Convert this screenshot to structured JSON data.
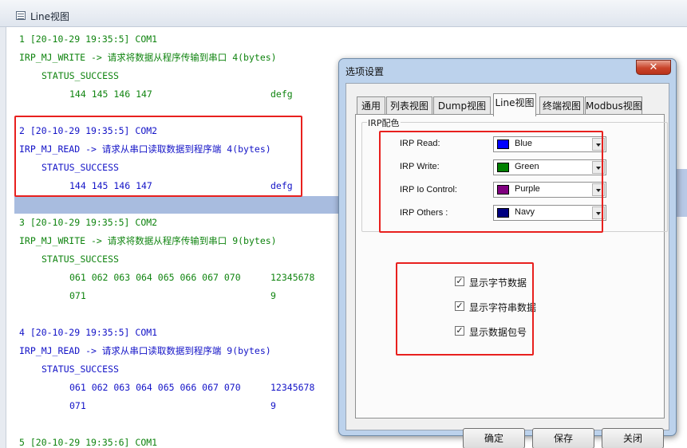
{
  "window": {
    "title": "Line视图"
  },
  "log": [
    {
      "header": "1 [20-10-29 19:35:5] COM1",
      "request": "IRP_MJ_WRITE -> 请求将数据从程序传输到串口 4(bytes)",
      "status": "STATUS_SUCCESS",
      "data": [
        {
          "hex": "144 145 146 147",
          "ascii": "defg"
        }
      ],
      "color": "#108410"
    },
    {
      "header": "2 [20-10-29 19:35:5] COM2",
      "request": "IRP_MJ_READ -> 请求从串口读取数据到程序端 4(bytes)",
      "status": "STATUS_SUCCESS",
      "data": [
        {
          "hex": "144 145 146 147",
          "ascii": "defg"
        }
      ],
      "color": "#1313c7"
    },
    {
      "header": "3 [20-10-29 19:35:5] COM2",
      "request": "IRP_MJ_WRITE -> 请求将数据从程序传输到串口 9(bytes)",
      "status": "STATUS_SUCCESS",
      "data": [
        {
          "hex": "061 062 063 064 065 066 067 070",
          "ascii": "12345678"
        },
        {
          "hex": "071",
          "ascii": "9"
        }
      ],
      "color": "#108410"
    },
    {
      "header": "4 [20-10-29 19:35:5] COM1",
      "request": "IRP_MJ_READ -> 请求从串口读取数据到程序端 9(bytes)",
      "status": "STATUS_SUCCESS",
      "data": [
        {
          "hex": "061 062 063 064 065 066 067 070",
          "ascii": "12345678"
        },
        {
          "hex": "071",
          "ascii": "9"
        }
      ],
      "color": "#1313c7"
    },
    {
      "header": "5 [20-10-29 19:35:6] COM1",
      "color": "#108410"
    }
  ],
  "dialog": {
    "title": "选项设置",
    "close_label": "✕",
    "tabs": [
      "通用",
      "列表视图",
      "Dump视图",
      "Line视图",
      "终端视图",
      "Modbus视图"
    ],
    "active_tab": "Line视图",
    "group_label": "IRP配色",
    "colors": [
      {
        "label": "IRP Read:",
        "value": "Blue",
        "swatch": "#0000ff"
      },
      {
        "label": "IRP Write:",
        "value": "Green",
        "swatch": "#008000"
      },
      {
        "label": "IRP Io Control:",
        "value": "Purple",
        "swatch": "#800080"
      },
      {
        "label": "IRP Others :",
        "value": "Navy",
        "swatch": "#000080"
      }
    ],
    "options": [
      {
        "label": "显示字节数据",
        "checked": true
      },
      {
        "label": "显示字符串数据",
        "checked": true
      },
      {
        "label": "显示数据包号",
        "checked": true
      }
    ],
    "buttons": {
      "ok": "确定",
      "save": "保存",
      "close": "关闭"
    }
  },
  "highlight_color": "#e8201e"
}
